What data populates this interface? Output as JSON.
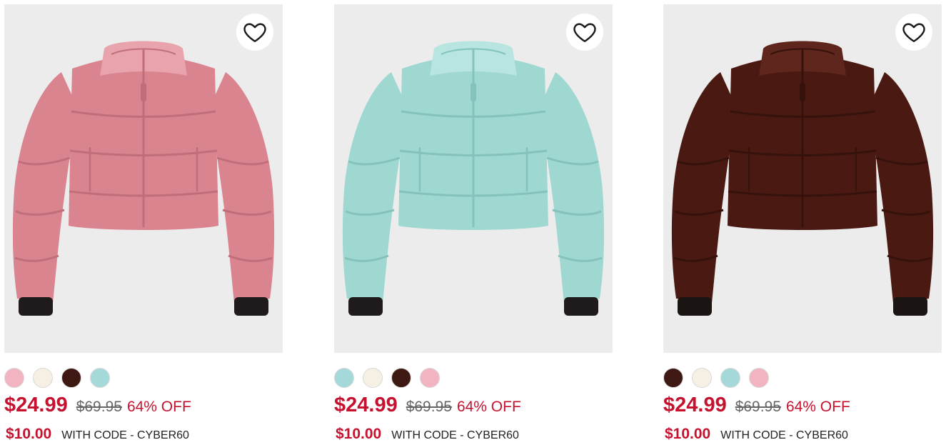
{
  "products": [
    {
      "colors": {
        "body": "#d9848f",
        "shade": "#c06f7a",
        "light": "#e8a3ad",
        "cuff": "#1f1a1c"
      },
      "swatches": [
        {
          "name": "pink",
          "color": "#f1b4c0"
        },
        {
          "name": "cream",
          "color": "#f6efe4"
        },
        {
          "name": "brown",
          "color": "#3e1812"
        },
        {
          "name": "aqua",
          "color": "#a5d9d9"
        }
      ],
      "price": "$24.99",
      "was": "$69.95",
      "off": "64% OFF",
      "code_price": "$10.00",
      "code_text": "WITH CODE - CYBER60",
      "favorite_icon": "heart-outline-icon"
    },
    {
      "colors": {
        "body": "#9fd8d1",
        "shade": "#84c2bb",
        "light": "#b8e5df",
        "cuff": "#1f1a1c"
      },
      "swatches": [
        {
          "name": "aqua",
          "color": "#a5d9d9"
        },
        {
          "name": "cream",
          "color": "#f6efe4"
        },
        {
          "name": "brown",
          "color": "#3e1812"
        },
        {
          "name": "pink",
          "color": "#f1b4c0"
        }
      ],
      "price": "$24.99",
      "was": "$69.95",
      "off": "64% OFF",
      "code_price": "$10.00",
      "code_text": "WITH CODE - CYBER60",
      "favorite_icon": "heart-outline-icon"
    },
    {
      "colors": {
        "body": "#4a1a12",
        "shade": "#36120c",
        "light": "#5e261c",
        "cuff": "#1a1412"
      },
      "swatches": [
        {
          "name": "brown",
          "color": "#3e1812"
        },
        {
          "name": "cream",
          "color": "#f6efe4"
        },
        {
          "name": "aqua",
          "color": "#a5d9d9"
        },
        {
          "name": "pink",
          "color": "#f1b4c0"
        }
      ],
      "price": "$24.99",
      "was": "$69.95",
      "off": "64% OFF",
      "code_price": "$10.00",
      "code_text": "WITH CODE - CYBER60",
      "favorite_icon": "heart-outline-icon"
    }
  ]
}
